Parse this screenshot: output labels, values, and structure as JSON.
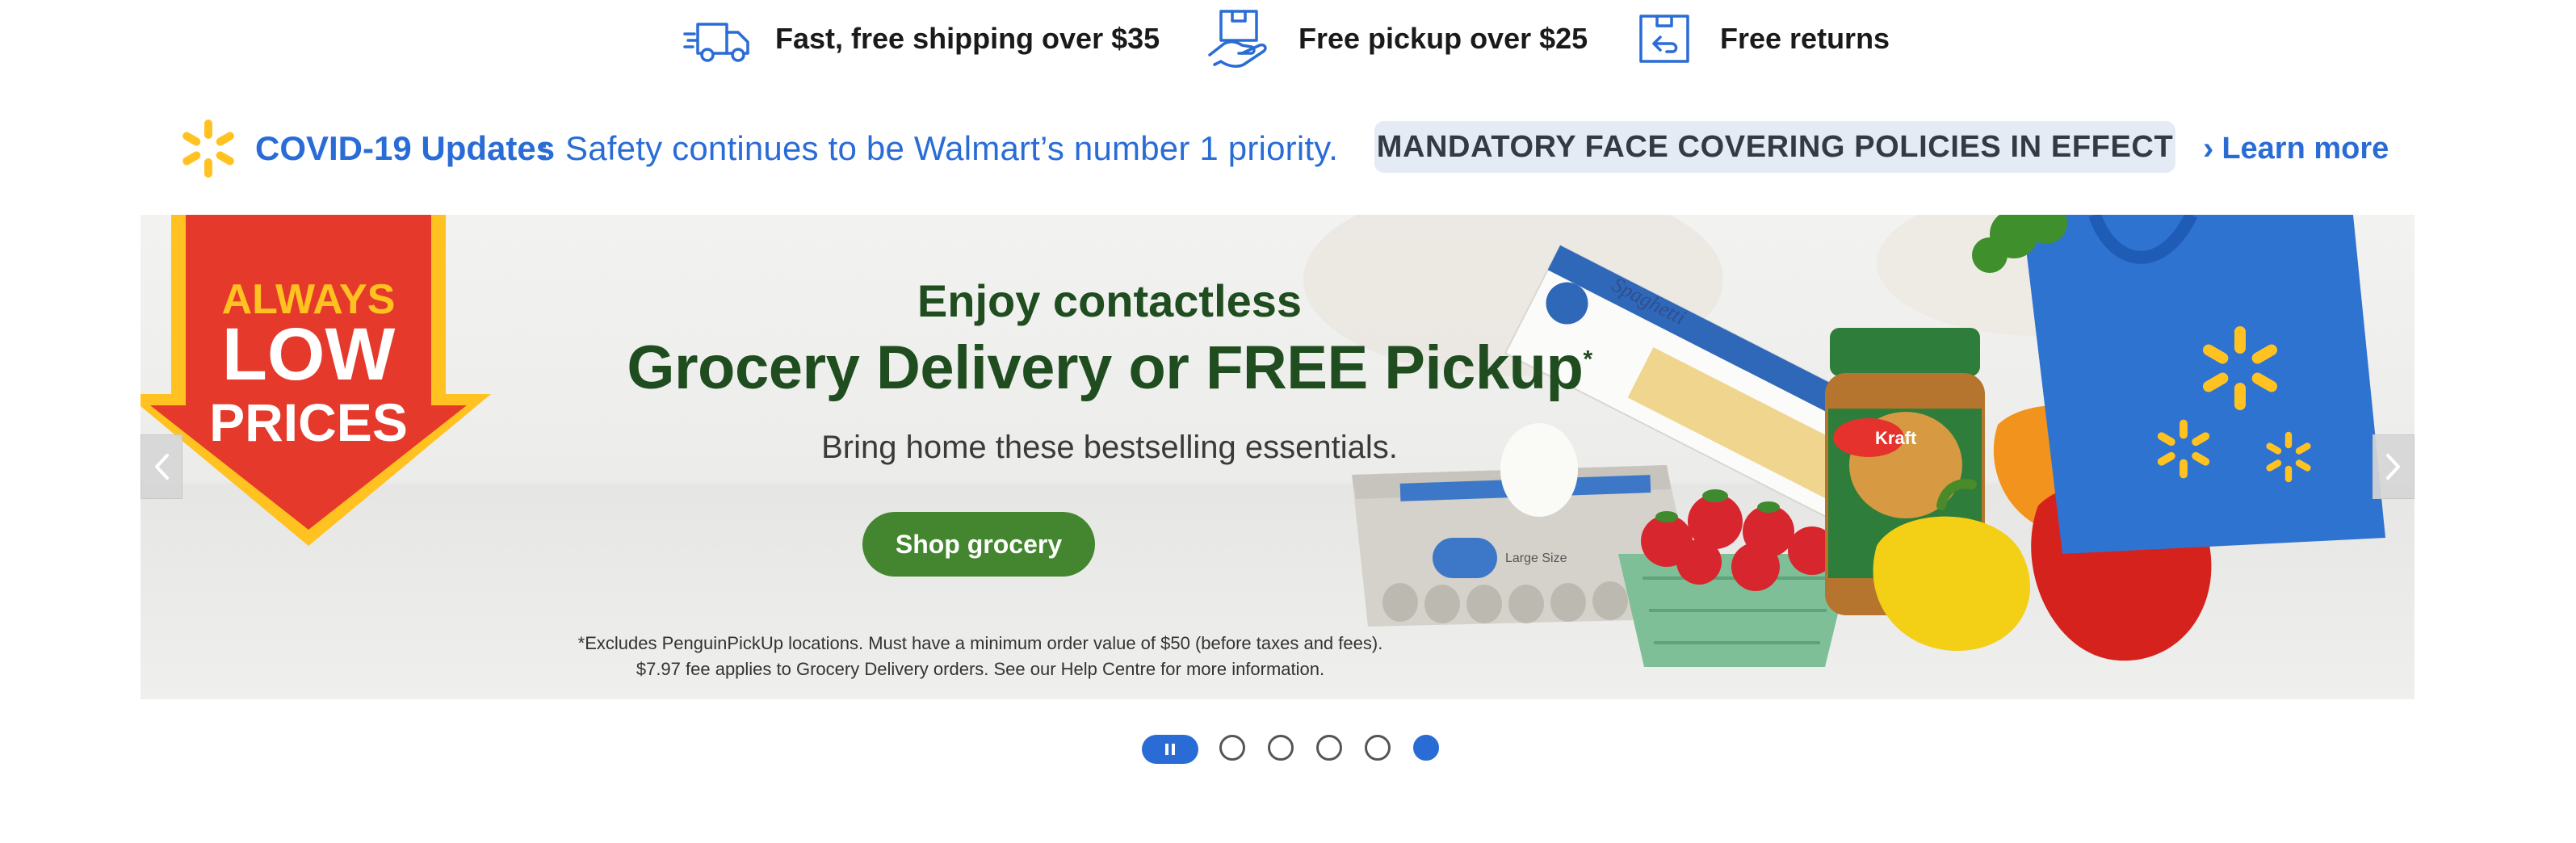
{
  "perks": [
    {
      "icon": "delivery-truck-icon",
      "label": "Fast, free shipping over $35"
    },
    {
      "icon": "pickup-hand-box-icon",
      "label": "Free pickup over $25"
    },
    {
      "icon": "returns-box-icon",
      "label": "Free returns"
    }
  ],
  "covid": {
    "icon": "walmart-spark-icon",
    "title": "COVID-19 Updates",
    "colon": ":",
    "message": "Safety continues to be Walmart’s number 1 priority.",
    "mandatory": "MANDATORY FACE COVERING POLICIES IN EFFECT",
    "learn_more": "Learn more"
  },
  "hero": {
    "badge": [
      "ALWAYS",
      "LOW",
      "PRICES"
    ],
    "line1": "Enjoy contactless",
    "line2": "Grocery Delivery or FREE Pickup",
    "line2_mark": "*",
    "line3": "Bring home these bestselling essentials.",
    "cta": "Shop grocery",
    "fine_print_1": "*Excludes PenguinPickUp locations. Must have a minimum order value of $50 (before taxes and fees).",
    "fine_print_2": "$7.97 fee applies to Grocery Delivery orders. See our Help Centre for more information.",
    "product_labels": {
      "pasta": "Spaghetti",
      "peanut_butter": "Kraft",
      "eggs": "Large Size"
    }
  },
  "carousel": {
    "slide_count": 5,
    "active_slide": 5
  },
  "colors": {
    "brand_blue": "#2a6cd6",
    "spark_yellow": "#ffc220",
    "cta_green": "#44862f",
    "headline_green": "#1f4d1f",
    "badge_red": "#e53a2b"
  }
}
